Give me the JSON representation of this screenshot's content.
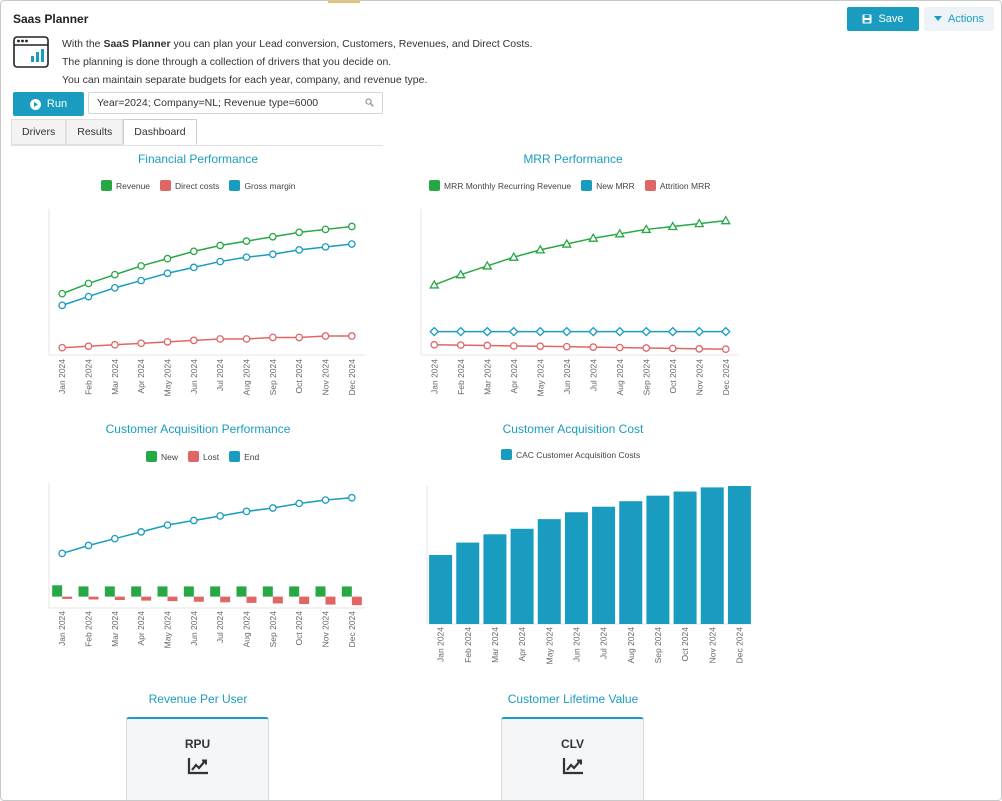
{
  "app": {
    "title": "Saas Planner"
  },
  "toolbar": {
    "save_label": "Save",
    "actions_label": "Actions"
  },
  "intro": {
    "line1_prefix": "With the ",
    "line1_bold": "SaaS Planner",
    "line1_suffix": " you can plan your Lead conversion, Customers, Revenues, and Direct Costs.",
    "line2": "The planning is done through a collection of drivers that you decide on.",
    "line3": "You can maintain separate budgets for each year, company, and revenue type."
  },
  "run": {
    "label": "Run",
    "params": "Year=2024; Company=NL; Revenue type=6000"
  },
  "tabs": [
    {
      "label": "Drivers",
      "active": false
    },
    {
      "label": "Results",
      "active": false
    },
    {
      "label": "Dashboard",
      "active": true
    }
  ],
  "colors": {
    "accent": "#1a9cc0",
    "green": "#28a745",
    "red": "#e06666",
    "blue": "#1a9cc0"
  },
  "months": [
    "Jan 2024",
    "Feb 2024",
    "Mar 2024",
    "Apr 2024",
    "May 2024",
    "Jun 2024",
    "Jul 2024",
    "Aug 2024",
    "Sep 2024",
    "Oct 2024",
    "Nov 2024",
    "Dec 2024"
  ],
  "chart_data": [
    {
      "id": "financial",
      "type": "line",
      "title": "Financial Performance",
      "categories": [
        "Jan 2024",
        "Feb 2024",
        "Mar 2024",
        "Apr 2024",
        "May 2024",
        "Jun 2024",
        "Jul 2024",
        "Aug 2024",
        "Sep 2024",
        "Oct 2024",
        "Nov 2024",
        "Dec 2024"
      ],
      "ylim": [
        0,
        100
      ],
      "marker": "circle",
      "series": [
        {
          "name": "Revenue",
          "color": "#28a745",
          "values": [
            42,
            49,
            55,
            61,
            66,
            71,
            75,
            78,
            81,
            84,
            86,
            88
          ]
        },
        {
          "name": "Direct costs",
          "color": "#e06666",
          "values": [
            5,
            6,
            7,
            8,
            9,
            10,
            11,
            11,
            12,
            12,
            13,
            13
          ]
        },
        {
          "name": "Gross margin",
          "color": "#1a9cc0",
          "values": [
            34,
            40,
            46,
            51,
            56,
            60,
            64,
            67,
            69,
            72,
            74,
            76
          ]
        }
      ],
      "legend": "top"
    },
    {
      "id": "mrr",
      "type": "line",
      "title": "MRR Performance",
      "categories": [
        "Jan 2024",
        "Feb 2024",
        "Mar 2024",
        "Apr 2024",
        "May 2024",
        "Jun 2024",
        "Jul 2024",
        "Aug 2024",
        "Sep 2024",
        "Oct 2024",
        "Nov 2024",
        "Dec 2024"
      ],
      "ylim": [
        0,
        100
      ],
      "series": [
        {
          "name": "MRR Monthly Recurring Revenue",
          "color": "#28a745",
          "marker": "triangle",
          "values": [
            48,
            55,
            61,
            67,
            72,
            76,
            80,
            83,
            86,
            88,
            90,
            92
          ]
        },
        {
          "name": "New MRR",
          "color": "#1a9cc0",
          "marker": "diamond",
          "values": [
            16,
            16,
            16,
            16,
            16,
            16,
            16,
            16,
            16,
            16,
            16,
            16
          ]
        },
        {
          "name": "Attrition MRR",
          "color": "#e06666",
          "marker": "circle",
          "values": [
            7,
            6.8,
            6.5,
            6.2,
            6,
            5.7,
            5.4,
            5.1,
            4.8,
            4.5,
            4.2,
            4
          ]
        }
      ],
      "legend": "top"
    },
    {
      "id": "acquisition",
      "type": "line",
      "title": "Customer Acquisition Performance",
      "categories": [
        "Jan 2024",
        "Feb 2024",
        "Mar 2024",
        "Apr 2024",
        "May 2024",
        "Jun 2024",
        "Jul 2024",
        "Aug 2024",
        "Sep 2024",
        "Oct 2024",
        "Nov 2024",
        "Dec 2024"
      ],
      "ylim": [
        -10,
        100
      ],
      "series": [
        {
          "name": "New",
          "color": "#28a745",
          "type": "bar",
          "values": [
            10,
            9,
            9,
            9,
            9,
            9,
            9,
            9,
            9,
            9,
            9,
            9
          ]
        },
        {
          "name": "Lost",
          "color": "#e06666",
          "type": "bar",
          "values": [
            -2,
            -2.5,
            -3,
            -3.5,
            -4,
            -4.5,
            -5,
            -5.5,
            -6,
            -6.5,
            -7,
            -7.5
          ]
        },
        {
          "name": "End",
          "color": "#1a9cc0",
          "type": "line",
          "values": [
            38,
            45,
            51,
            57,
            63,
            67,
            71,
            75,
            78,
            82,
            85,
            87
          ]
        }
      ],
      "legend": "top"
    },
    {
      "id": "cac",
      "type": "bar",
      "title": "Customer Acquisition Cost",
      "categories": [
        "Jan 2024",
        "Feb 2024",
        "Mar 2024",
        "Apr 2024",
        "May 2024",
        "Jun 2024",
        "Jul 2024",
        "Aug 2024",
        "Sep 2024",
        "Oct 2024",
        "Nov 2024",
        "Dec 2024"
      ],
      "ylim": [
        0,
        100
      ],
      "series": [
        {
          "name": "CAC Customer Acquisition Costs",
          "color": "#1a9cc0",
          "values": [
            50,
            59,
            65,
            69,
            76,
            81,
            85,
            89,
            93,
            96,
            99,
            100
          ]
        }
      ],
      "legend": "top"
    }
  ],
  "kpis": [
    {
      "title": "Revenue Per User",
      "label": "RPU"
    },
    {
      "title": "Customer Lifetime Value",
      "label": "CLV"
    }
  ]
}
